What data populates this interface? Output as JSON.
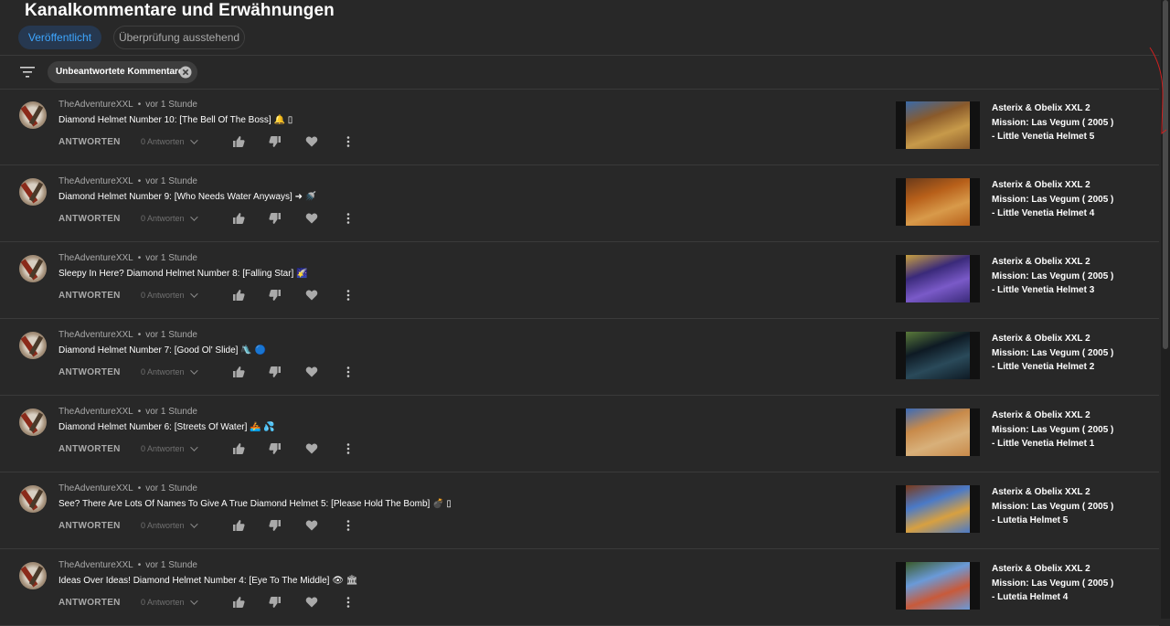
{
  "page": {
    "title": "Kanalkommentare und Erwähnungen",
    "tabs": [
      {
        "label": "Veröffentlicht",
        "active": true
      },
      {
        "label": "Überprüfung ausstehend",
        "active": false
      }
    ],
    "filter_chip": "Unbeantwortete Kommentare"
  },
  "colors": {
    "background": "#282828",
    "accent": "#3ea6ff",
    "active_tab_bg": "#263850",
    "muted_text": "#aaaaaa"
  },
  "comments": [
    {
      "author": "TheAdventureXXL",
      "time": "vor 1 Stunde",
      "text": "Diamond Helmet Number 10: [The Bell Of The Boss] 🔔 ▯",
      "reply_label": "ANTWORTEN",
      "replies": "0 Antworten",
      "video": {
        "line1": "Asterix & Obelix XXL 2",
        "line2": "Mission: Las Vegum ( 2005 )",
        "line3": "- Little Venetia Helmet 5",
        "thumb_colors": [
          "#8a5a2a",
          "#c79a4a",
          "#3a6aa8"
        ]
      }
    },
    {
      "author": "TheAdventureXXL",
      "time": "vor 1 Stunde",
      "text": "Diamond Helmet Number 9: [Who Needs Water Anyways] ➜ 🚿",
      "reply_label": "ANTWORTEN",
      "replies": "0 Antworten",
      "video": {
        "line1": "Asterix & Obelix XXL 2",
        "line2": "Mission: Las Vegum ( 2005 )",
        "line3": "- Little Venetia Helmet 4",
        "thumb_colors": [
          "#b8601a",
          "#d89a4a",
          "#6a3a1a"
        ]
      }
    },
    {
      "author": "TheAdventureXXL",
      "time": "vor 1 Stunde",
      "text": "Sleepy In Here? Diamond Helmet Number 8: [Falling Star] 🌠",
      "reply_label": "ANTWORTEN",
      "replies": "0 Antworten",
      "video": {
        "line1": "Asterix & Obelix XXL 2",
        "line2": "Mission: Las Vegum ( 2005 )",
        "line3": "- Little Venetia Helmet 3",
        "thumb_colors": [
          "#3a2a7a",
          "#7a5ac8",
          "#c8a040"
        ]
      }
    },
    {
      "author": "TheAdventureXXL",
      "time": "vor 1 Stunde",
      "text": "Diamond Helmet Number 7: [Good Ol' Slide] 🛝 🔵",
      "reply_label": "ANTWORTEN",
      "replies": "0 Antworten",
      "video": {
        "line1": "Asterix & Obelix XXL 2",
        "line2": "Mission: Las Vegum ( 2005 )",
        "line3": "- Little Venetia Helmet 2",
        "thumb_colors": [
          "#0e1a24",
          "#2a4a5a",
          "#5a7a3a"
        ]
      }
    },
    {
      "author": "TheAdventureXXL",
      "time": "vor 1 Stunde",
      "text": "Diamond Helmet Number 6: [Streets Of Water] 🚣 💦",
      "reply_label": "ANTWORTEN",
      "replies": "0 Antworten",
      "video": {
        "line1": "Asterix & Obelix XXL 2",
        "line2": "Mission: Las Vegum ( 2005 )",
        "line3": "- Little Venetia Helmet 1",
        "thumb_colors": [
          "#c88a4a",
          "#d8b07a",
          "#3a6ab8"
        ]
      }
    },
    {
      "author": "TheAdventureXXL",
      "time": "vor 1 Stunde",
      "text": "See? There Are Lots Of Names To Give A True Diamond Helmet 5: [Please Hold The Bomb] 💣 ▯",
      "reply_label": "ANTWORTEN",
      "replies": "0 Antworten",
      "video": {
        "line1": "Asterix & Obelix XXL 2",
        "line2": "Mission: Las Vegum ( 2005 )",
        "line3": "- Lutetia Helmet 5",
        "thumb_colors": [
          "#4a7ac8",
          "#d8a040",
          "#7a3a1a"
        ]
      }
    },
    {
      "author": "TheAdventureXXL",
      "time": "vor 1 Stunde",
      "text": "Ideas Over Ideas! Diamond Helmet Number 4: [Eye To The Middle] 👁 🏛",
      "reply_label": "ANTWORTEN",
      "replies": "0 Antworten",
      "video": {
        "line1": "Asterix & Obelix XXL 2",
        "line2": "Mission: Las Vegum ( 2005 )",
        "line3": "- Lutetia Helmet 4",
        "thumb_colors": [
          "#6a9ad8",
          "#c85a3a",
          "#3a5a2a"
        ]
      }
    }
  ]
}
